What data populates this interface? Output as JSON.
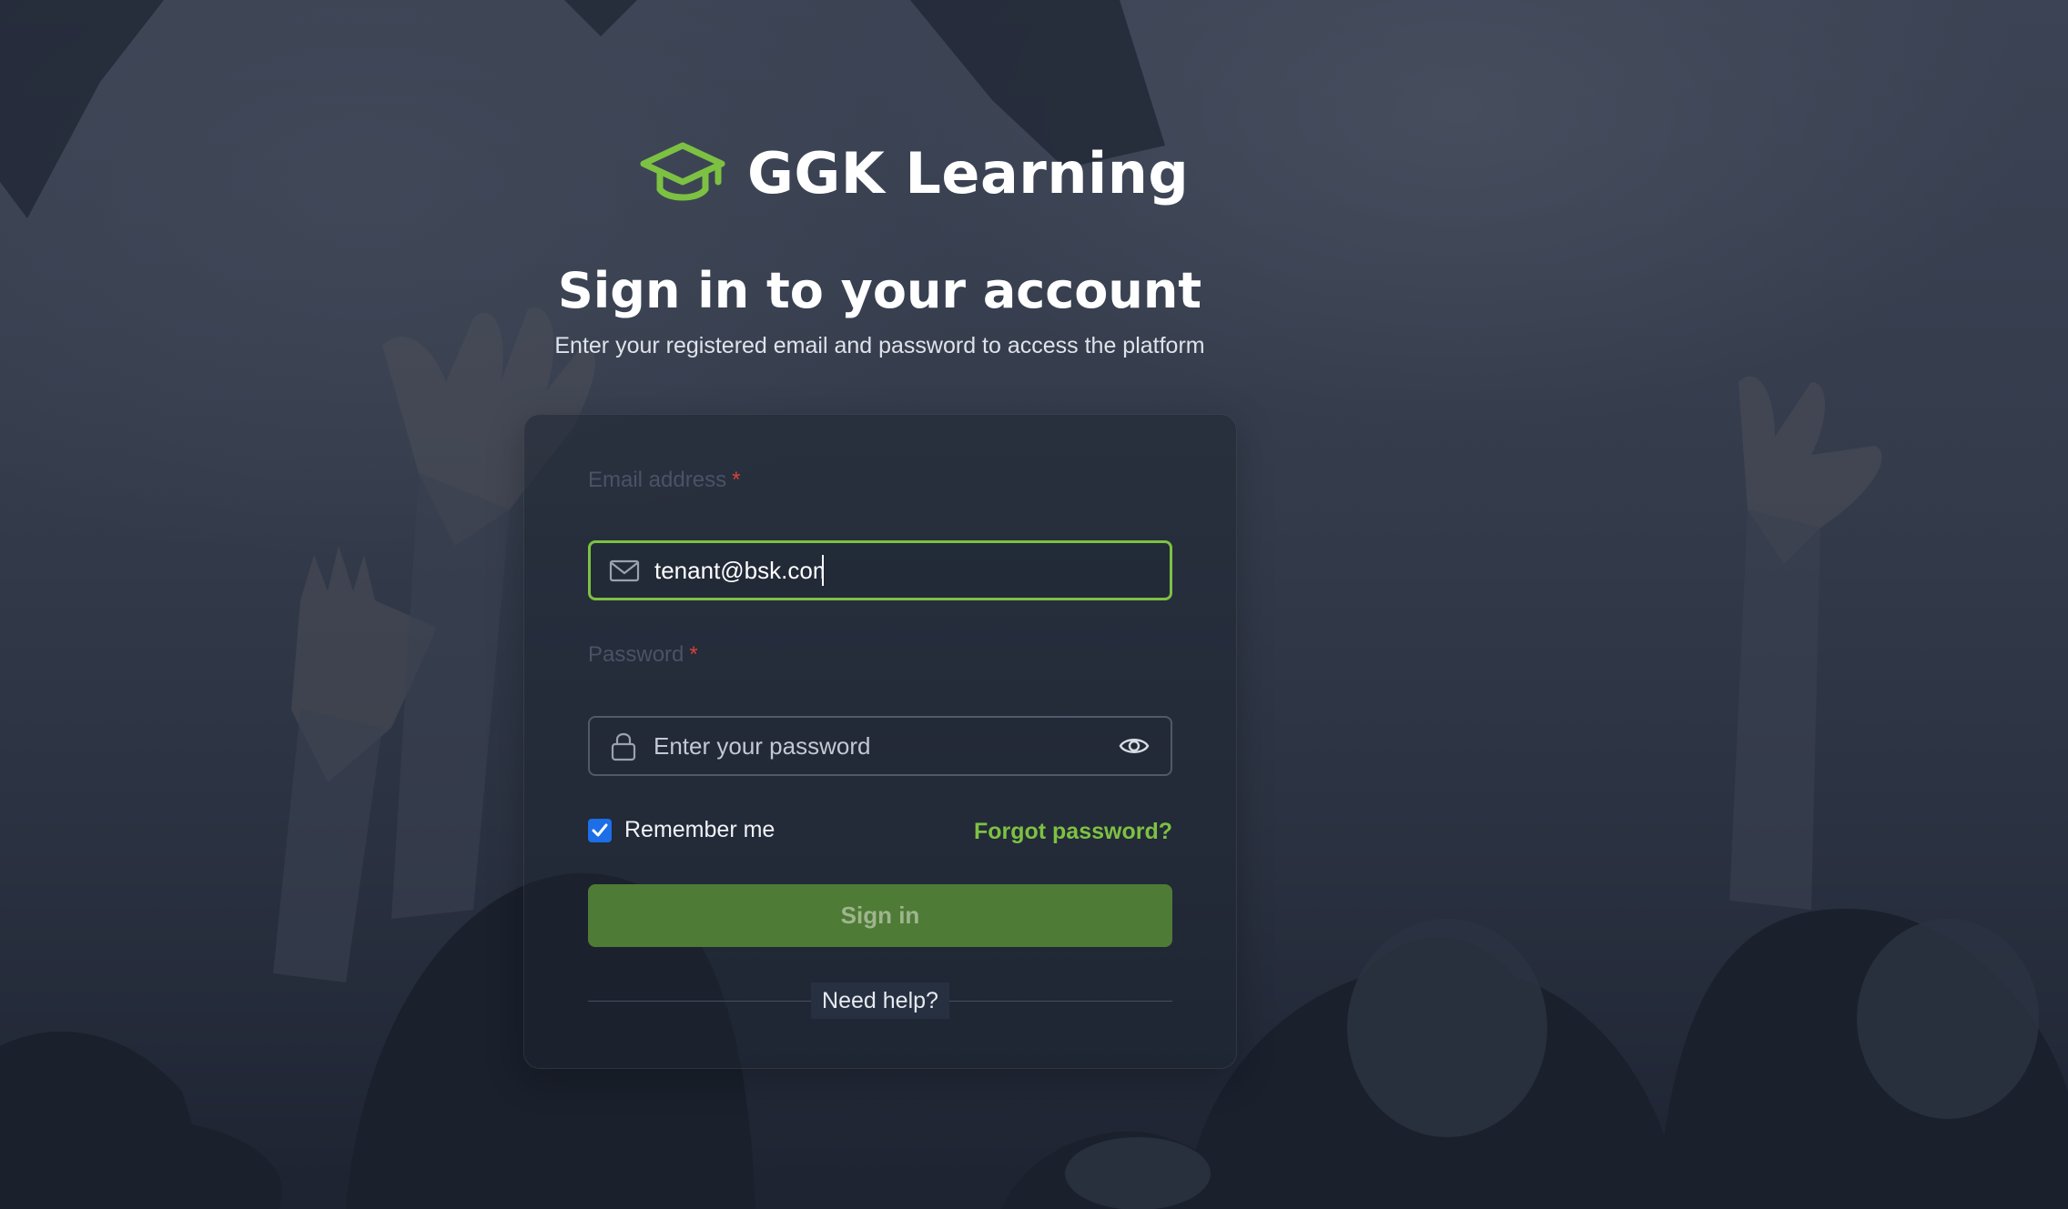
{
  "brand": {
    "name": "GGK Learning",
    "accent": "#7dc142"
  },
  "header": {
    "title": "Sign in to your account",
    "subtitle": "Enter your registered email and password to access the platform"
  },
  "form": {
    "email": {
      "label": "Email address",
      "required_mark": "*",
      "value": "tenant@bsk.com",
      "icon": "mail-icon"
    },
    "password": {
      "label": "Password",
      "required_mark": "*",
      "placeholder": "Enter your password",
      "value": "",
      "icon": "lock-icon",
      "toggle_icon": "eye-icon"
    },
    "remember_me": {
      "label": "Remember me",
      "checked": true
    },
    "forgot_password": "Forgot password?",
    "submit_label": "Sign in",
    "help_label": "Need help?"
  },
  "colors": {
    "checkbox": "#1c6fe6",
    "required": "#d8423a",
    "button": "#4e7b36"
  }
}
